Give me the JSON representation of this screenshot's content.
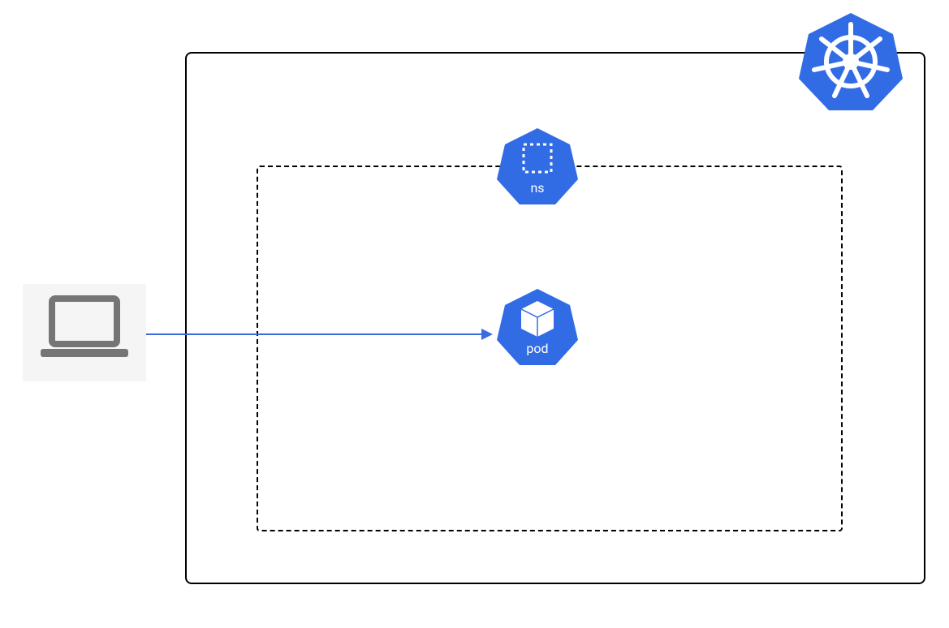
{
  "diagram": {
    "ns_label": "ns",
    "pod_label": "pod",
    "colors": {
      "kubernetes_blue": "#326CE5",
      "arrow_blue": "#3b6ae1",
      "laptop_gray": "#757575",
      "laptop_bg": "#f5f5f5"
    }
  }
}
